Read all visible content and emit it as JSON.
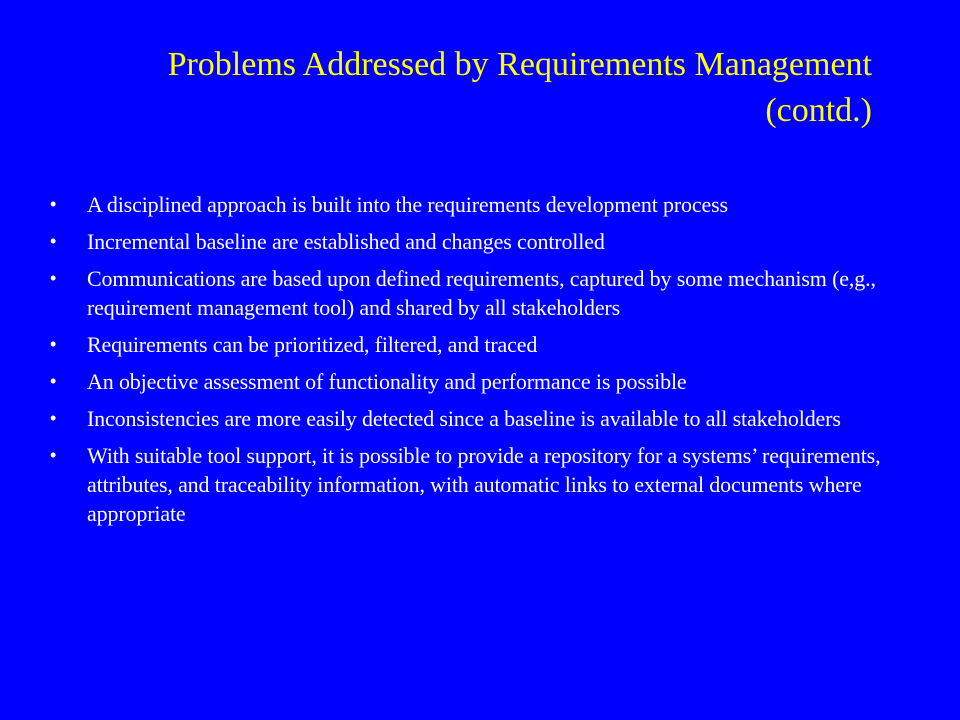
{
  "slide": {
    "title_line_1": "Problems Addressed by Requirements Management",
    "title_line_2": "(contd.)",
    "bullet_symbol": "•",
    "bullets": [
      "A disciplined approach is built into the requirements development process",
      "Incremental baseline are established and changes controlled",
      "Communications are based upon defined requirements, captured by some mechanism (e,g., requirement management tool) and shared by all stakeholders",
      "Requirements can be prioritized, filtered, and traced",
      "An objective assessment of functionality and performance is possible",
      "Inconsistencies are more easily detected since a baseline is available to all stakeholders",
      "With  suitable tool support, it is possible to provide a repository for a systems’ requirements, attributes, and traceability information, with automatic links to external documents where appropriate"
    ]
  },
  "colors": {
    "background": "#0000ff",
    "title": "#ffff00",
    "body_text": "#ffffff"
  }
}
